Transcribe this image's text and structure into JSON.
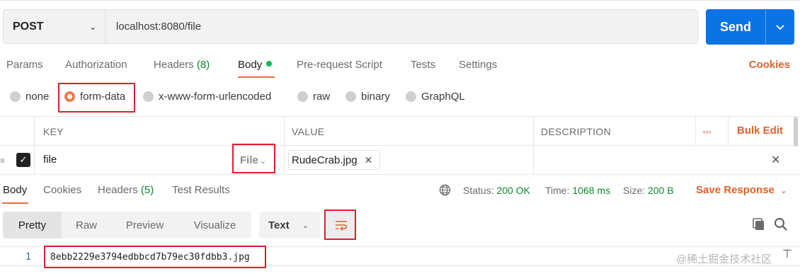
{
  "request": {
    "method": "POST",
    "url": "localhost:8080/file",
    "send_label": "Send"
  },
  "tabs": {
    "params": "Params",
    "authorization": "Authorization",
    "headers": "Headers",
    "headers_count": "(8)",
    "body": "Body",
    "prerequest": "Pre-request Script",
    "tests": "Tests",
    "settings": "Settings",
    "cookies": "Cookies"
  },
  "body_types": {
    "none": "none",
    "form_data": "form-data",
    "urlencoded": "x-www-form-urlencoded",
    "raw": "raw",
    "binary": "binary",
    "graphql": "GraphQL",
    "selected": "form-data"
  },
  "table": {
    "headers": {
      "key": "KEY",
      "value": "VALUE",
      "description": "DESCRIPTION"
    },
    "bulk_edit": "Bulk Edit",
    "rows": [
      {
        "key": "file",
        "type": "File",
        "value": "RudeCrab.jpg"
      }
    ]
  },
  "response": {
    "tabs": {
      "body": "Body",
      "cookies": "Cookies",
      "headers": "Headers",
      "headers_count": "(5)",
      "tests": "Test Results"
    },
    "status_label": "Status:",
    "status_value": "200 OK",
    "time_label": "Time:",
    "time_value": "1068 ms",
    "size_label": "Size:",
    "size_value": "200 B",
    "save_label": "Save Response",
    "views": [
      "Pretty",
      "Raw",
      "Preview",
      "Visualize"
    ],
    "format": "Text",
    "lines": [
      {
        "number": "1",
        "text": "8ebb2229e3794edbbcd7b79ec30fdbb3.jpg"
      }
    ]
  },
  "watermark": "@稀土掘金技术社区",
  "colors": {
    "accent": "#e0612b",
    "send": "#0b73e4",
    "status_green": "#0c8a2c",
    "highlight_box": "#e21b2c"
  }
}
